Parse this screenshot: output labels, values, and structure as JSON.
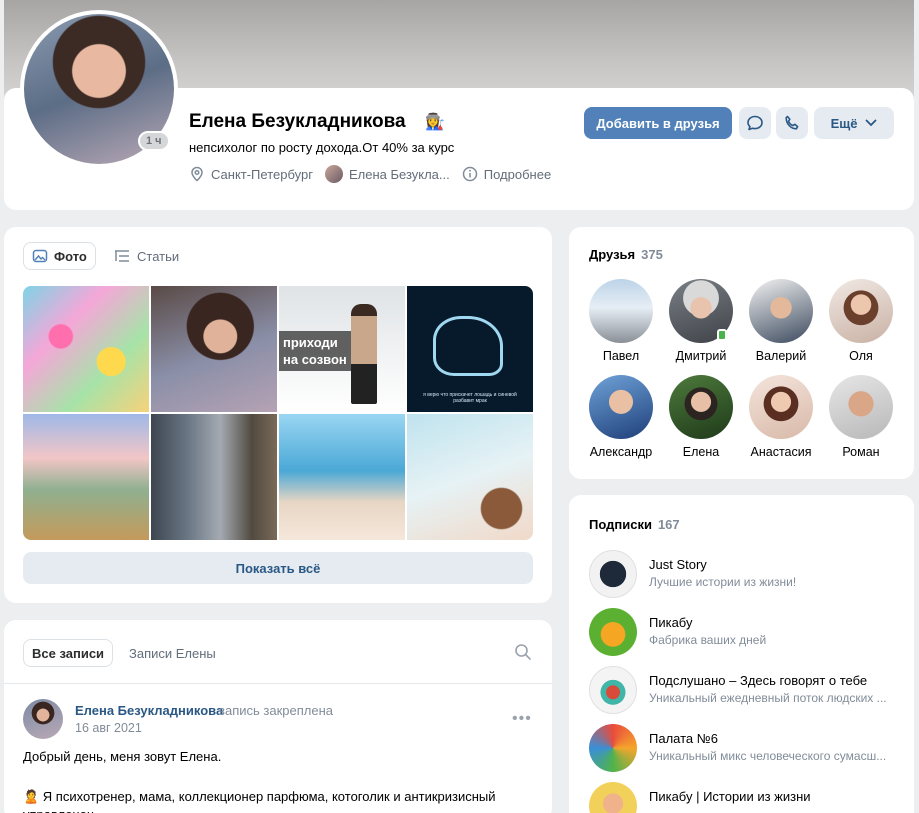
{
  "profile": {
    "name": "Елена Безукладникова",
    "emoji": "👩‍🏭",
    "status": "непсихолог по росту дохода.От 40% за курс",
    "city": "Санкт-Петербург",
    "relative": "Елена Безукла...",
    "more_info": "Подробнее",
    "online": "1 ч"
  },
  "actions": {
    "add_friend": "Добавить в друзья",
    "more": "Ещё"
  },
  "photos": {
    "tab_photo": "Фото",
    "tab_articles": "Статьи",
    "photo3_caption": "приходи\nна созвон",
    "photo4_caption": "я верю что прискачет лошадь и синевой разбавит мрак",
    "show_all": "Показать всё"
  },
  "posts": {
    "tab_all": "Все записи",
    "tab_hers": "Записи Елены",
    "author": "Елена Безукладникова",
    "pinned": "запись закреплена",
    "date": "16 авг 2021",
    "text1": "Добрый день, меня зовут Елена.",
    "text2": "🙎 Я психотренер, мама, коллекционер парфюма, котоголик и антикризисный управленец"
  },
  "friends": {
    "title": "Друзья",
    "count": "375",
    "items": [
      {
        "name": "Павел"
      },
      {
        "name": "Дмитрий"
      },
      {
        "name": "Валерий"
      },
      {
        "name": "Оля"
      },
      {
        "name": "Александр"
      },
      {
        "name": "Елена"
      },
      {
        "name": "Анастасия"
      },
      {
        "name": "Роман"
      }
    ]
  },
  "subscriptions": {
    "title": "Подписки",
    "count": "167",
    "items": [
      {
        "title": "Just Story",
        "desc": "Лучшие истории из жизни!"
      },
      {
        "title": "Пикабу",
        "desc": "Фабрика ваших дней"
      },
      {
        "title": "Подслушано – Здесь говорят о тебе",
        "desc": "Уникальный ежедневный поток людских ..."
      },
      {
        "title": "Палата №6",
        "desc": "Уникальный микс человеческого сумасш..."
      },
      {
        "title": "Пикабу | Истории из жизни",
        "desc": ""
      }
    ]
  },
  "colors": {
    "accent": "#5181b8",
    "link": "#2a5885",
    "secondary_bg": "#e5ebf1",
    "page_bg": "#edeef0",
    "online": "#4bb34b"
  }
}
